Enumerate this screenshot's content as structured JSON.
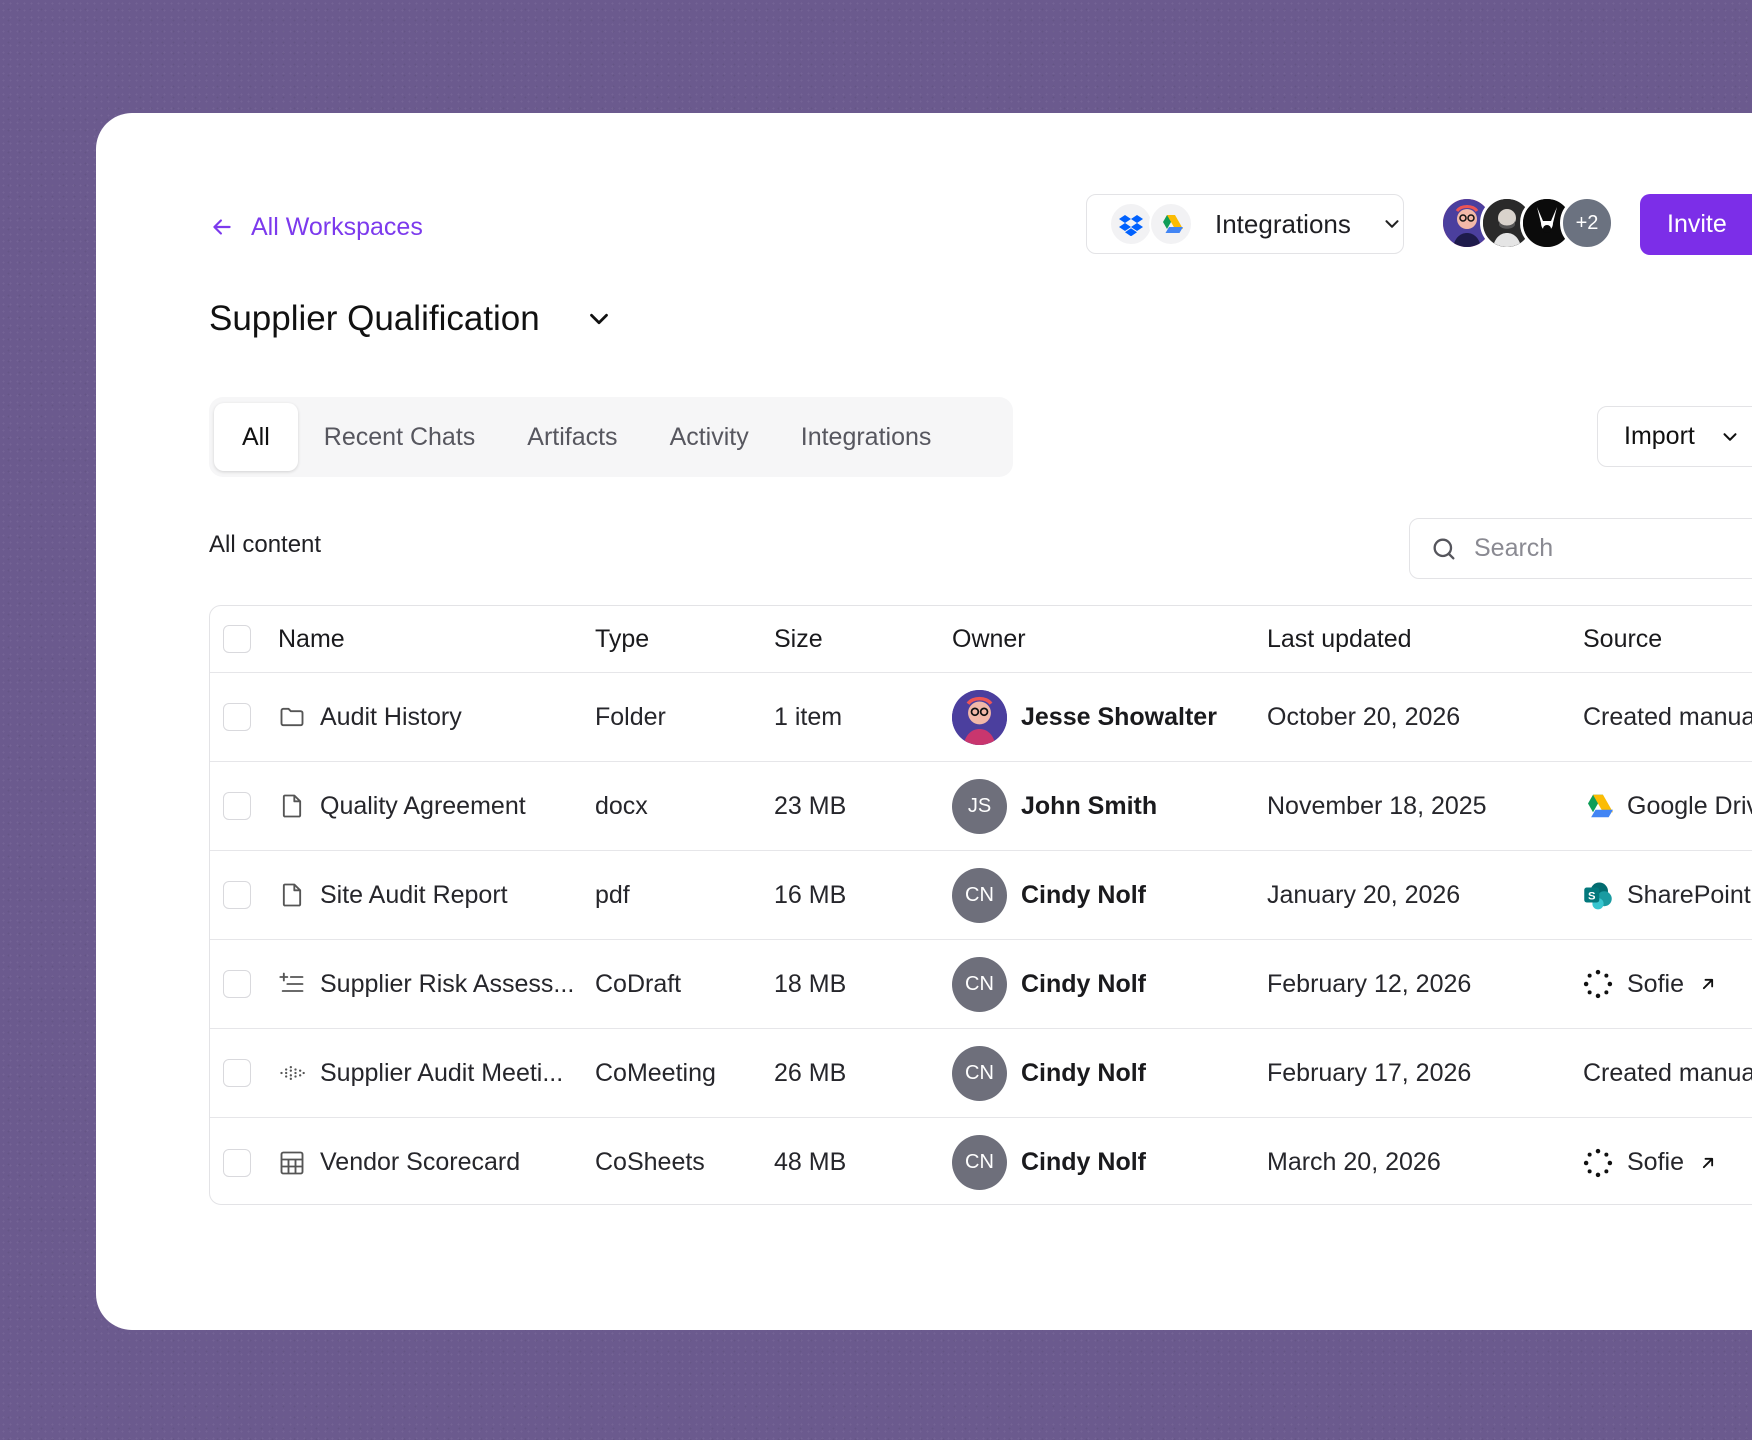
{
  "nav": {
    "back_label": "All Workspaces"
  },
  "header": {
    "integrations_label": "Integrations",
    "invite_label": "Invite",
    "members_more": "+2"
  },
  "workspace": {
    "title": "Supplier Qualification"
  },
  "tabs": [
    {
      "label": "All",
      "active": true
    },
    {
      "label": "Recent Chats"
    },
    {
      "label": "Artifacts"
    },
    {
      "label": "Activity"
    },
    {
      "label": "Integrations"
    }
  ],
  "import_label": "Import",
  "content": {
    "section_label": "All content",
    "search_placeholder": "Search",
    "columns": [
      "Name",
      "Type",
      "Size",
      "Owner",
      "Last updated",
      "Source"
    ],
    "rows": [
      {
        "name": "Audit History",
        "icon": "folder-icon",
        "type": "Folder",
        "size": "1 item",
        "owner": "Jesse Showalter",
        "owner_initials": "",
        "updated": "October 20, 2026",
        "source": "Created manua",
        "source_icon": ""
      },
      {
        "name": "Quality Agreement",
        "icon": "file-icon",
        "type": "docx",
        "size": "23 MB",
        "owner": "John Smith",
        "owner_initials": "JS",
        "updated": "November 18, 2025",
        "source": "Google Driv",
        "source_icon": "google-drive-icon"
      },
      {
        "name": "Site Audit Report",
        "icon": "file-icon",
        "type": "pdf",
        "size": "16 MB",
        "owner": "Cindy Nolf",
        "owner_initials": "CN",
        "updated": "January 20, 2026",
        "source": "SharePoint",
        "source_icon": "sharepoint-icon"
      },
      {
        "name": "Supplier Risk Assess...",
        "icon": "list-icon",
        "type": "CoDraft",
        "size": "18 MB",
        "owner": "Cindy Nolf",
        "owner_initials": "CN",
        "updated": "February 12, 2026",
        "source": "Sofie",
        "source_icon": "sofie-icon"
      },
      {
        "name": "Supplier Audit Meeti...",
        "icon": "waveform-icon",
        "type": "CoMeeting",
        "size": "26 MB",
        "owner": "Cindy Nolf",
        "owner_initials": "CN",
        "updated": "February 17, 2026",
        "source": "Created manua",
        "source_icon": ""
      },
      {
        "name": "Vendor Scorecard",
        "icon": "table-icon",
        "type": "CoSheets",
        "size": "48 MB",
        "owner": "Cindy Nolf",
        "owner_initials": "CN",
        "updated": "March 20, 2026",
        "source": "Sofie",
        "source_icon": "sofie-icon"
      }
    ]
  },
  "colors": {
    "accent": "#7c2ee8",
    "background": "#6b5a8e"
  }
}
